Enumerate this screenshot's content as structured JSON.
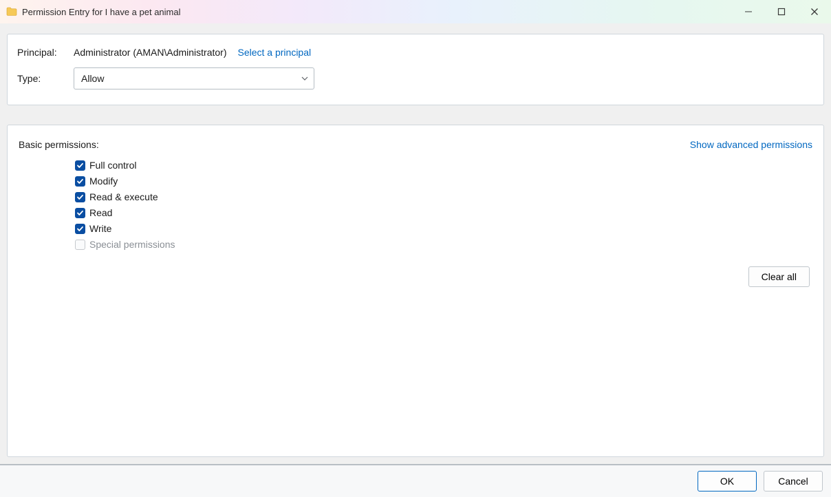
{
  "titlebar": {
    "title": "Permission Entry for I have a pet animal"
  },
  "top_panel": {
    "principal_label": "Principal:",
    "principal_value": "Administrator (AMAN\\Administrator)",
    "select_principal_link": "Select a principal",
    "type_label": "Type:",
    "type_value": "Allow"
  },
  "perms_panel": {
    "heading": "Basic permissions:",
    "advanced_link": "Show advanced permissions",
    "items": [
      {
        "label": "Full control",
        "checked": true,
        "disabled": false
      },
      {
        "label": "Modify",
        "checked": true,
        "disabled": false
      },
      {
        "label": "Read & execute",
        "checked": true,
        "disabled": false
      },
      {
        "label": "Read",
        "checked": true,
        "disabled": false
      },
      {
        "label": "Write",
        "checked": true,
        "disabled": false
      },
      {
        "label": "Special permissions",
        "checked": false,
        "disabled": true
      }
    ],
    "clear_all": "Clear all"
  },
  "footer": {
    "ok": "OK",
    "cancel": "Cancel"
  }
}
